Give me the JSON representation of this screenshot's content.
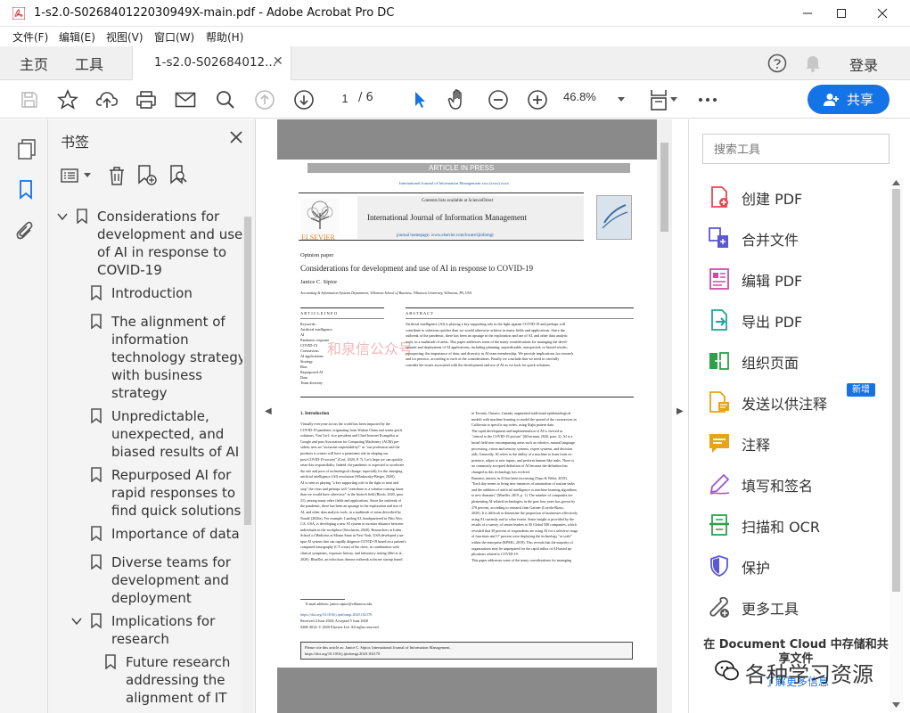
{
  "window": {
    "title": "1-s2.0-S026840122030949X-main.pdf - Adobe Acrobat Pro DC"
  },
  "menu": [
    "文件(F)",
    "编辑(E)",
    "视图(V)",
    "窗口(W)",
    "帮助(H)"
  ],
  "tabs": {
    "home": "主页",
    "tools": "工具",
    "document": "1-s2.0-S02684012...",
    "signin": "登录"
  },
  "toolbar": {
    "page_current": "1",
    "page_total": "/ 6",
    "zoom": "46.8%",
    "share": "共享"
  },
  "bookmarks": {
    "header": "书签",
    "items": [
      {
        "label_lines": [
          "Considerations for",
          "development and use",
          "of AI in response to",
          "COVID-19"
        ]
      },
      {
        "label_lines": [
          "Introduction"
        ]
      },
      {
        "label_lines": [
          "The alignment of",
          "information",
          "technology strategy",
          "with business",
          "strategy"
        ]
      },
      {
        "label_lines": [
          "Unpredictable,",
          "unexpected, and",
          "biased results of AI"
        ]
      },
      {
        "label_lines": [
          "Repurposed AI for",
          "rapid responses to",
          "find quick solutions"
        ]
      },
      {
        "label_lines": [
          "Importance of data"
        ]
      },
      {
        "label_lines": [
          "Diverse teams for",
          "development and",
          "deployment"
        ]
      },
      {
        "label_lines": [
          "Implications for",
          "research"
        ]
      },
      {
        "label_lines": [
          "Future research",
          "addressing the",
          "alignment of IT"
        ]
      }
    ]
  },
  "pdf": {
    "banner": "ARTICLE IN PRESS",
    "journal_ref": "International Journal of Information Management xxx (xxxx) xxxx",
    "contents_line": "Contents lists available at ScienceDirect",
    "journal_name": "International Journal of Information Management",
    "homepage": "journal homepage: www.elsevier.com/locate/ijinfomgt",
    "publisher": "ELSEVIER",
    "type": "Opinion paper",
    "title": "Considerations for development and use of AI in response to COVID-19",
    "author": "Janice C. Sipior",
    "affiliation": "Accounting & Information Systems Department, Villanova School of Business, Villanova University, Villanova, PA, USA",
    "article_info_hdr": "A R T I C L E   I N F O",
    "abstract_hdr": "A B S T R A C T",
    "keywords": [
      "Keywords:",
      "Artificial intelligence",
      "AI",
      "Pandemic response",
      "COVID-19",
      "Coronavirus",
      "AI applications",
      "Strategy",
      "Bias",
      "Repurposed AI",
      "Data",
      "Team diversity"
    ],
    "abstract_lines": [
      "Artificial intelligence (AI) is playing a key supporting role in the fight against COVID-19 and perhaps will",
      "contribute to solutions quicker than we would otherwise achieve in many fields and applications. Since the",
      "outbreak of the pandemic, there has been an upsurge in the exploration and use of AI, and other data analytic",
      "tools, in a multitude of areas. This paper addresses some of the many considerations for managing the devel-",
      "opment and deployment of AI applications, including planning; unpredictable, unexpected, or biased results;",
      "repurposing; the importance of data; and diversity in AI team membership. We provide implications for research",
      "and for practice, according to each of the considerations. Finally we conclude that we need to carefully",
      "consider the issues associated with the development and use of AI as we look for quick solutions."
    ],
    "section1": "1. Introduction",
    "col1_lines": [
      "Virtually everyone across the world has been impacted by the",
      "COVID-19 pandemic originating from Wuhan China and wants quick",
      "solutions. Vint Cerf, vice president and Chief Internet Evangelist at",
      "Google and past Association for Computing Machinery (ACM) pre-",
      "sident, sees an \"awesome responsibility!\" as \"our profession and the",
      "products it creates will have a prominent role in shaping our",
      "post-COVID-19 society\" (Cerf, 2020, P. 7). Let's hope we can quickly",
      "seize this responsibility. Indeed, the pandemic is expected to accelerate",
      "the rate and pace of technological change, especially for the emerging",
      "artificial intelligence (AI) revolution (Wladawsky-Berger, 2020).",
      "AI is seen as playing \"a key supporting role in the fight to treat and",
      "stop\" the virus and perhaps will \"contribute to a solution coming faster",
      "than we would have otherwise\" in the biotech field (Bloch, 2020, para.",
      "21), among many other fields and applications. Since the outbreak of",
      "the pandemic, there has been an upsurge in the exploration and use of",
      "AI, and other data analytic tools, in a multitude of areas described by",
      "Naudé (2020a). For example, Landing AI, headquartered in Palo Alto,",
      "CA, USA, is developing a new AI system to monitor distance between",
      "individuals in the workplace (Seecharan, 2020). Researchers at Icahn",
      "School of Medicine at Mount Sinai in New York, USA developed a un-",
      "ique AI system that can rapidly diagnose COVID-19 based on a patient's",
      "computed tomography (CT scans) of the chest, in combination with",
      "clinical symptoms, exposure history, and laboratory testing (Mei et al.,",
      "2020). BlueDot, an infectious disease outbreak software startup based"
    ],
    "col2_lines": [
      "in Toronto, Ontario, Canada, augmented traditional epidemiological",
      "models with machine learning to model the spread of the coronavirus in",
      "California to specific zip codes, using flight pattern data.",
      "The rapid development and implementation of AI is viewed as",
      "\"central to the COVID-19 picture\" (Silverman, 2020, para. 2). AI is a",
      "broad field now encompassing areas such as robotics, natural language",
      "processing, vision and sensory systems, expert systems, and decision",
      "aids. Generally, AI refers to the ability of a machine to learn from ex-",
      "perience, adjust to new inputs, and perform human-like tasks. There is",
      "no commonly accepted definition of AI because the definition has",
      "changed as this technology has evolved.",
      "Business interest in AI has been increasing (Tapo & Welat, 2018).",
      "\"Each day seems to bring new instances of automation of routine tasks",
      "and the addition of artificial intelligence or machine learning algorithms",
      "to new domains\" (Mueller, 2019, p. 1). The number of companies im-",
      "plementing AI-related technologies in the past four years has grown by",
      "270 percent, according to research firm Gartner (Loyola-Rizzo,",
      "2020). It is difficult to determine the proportion of businesses effectively",
      "using AI currently and to what extent. Some insight is provided by the",
      "results of a survey, of senior leaders at 30 Global 500 companies, which",
      "revealed that 30 percent of respondents are using AI for a selective range",
      "of functions and 17 percent were deploying the technology \"at scale\"",
      "within the enterprise (KPMG, 2019). This reveals that the majority of",
      "organizations may be unprepared for the rapid influx of AI-based ap-",
      "plications related to COVID-19.",
      "This paper addresses some of the many considerations for managing"
    ],
    "email": "E-mail address: janice.sipior@villanova.edu.",
    "doi": "https://doi.org/10.1016/j.ijinfomgt.2020.102170",
    "received": "Received 4 June 2020; Accepted 5 June 2020",
    "copyright": "0268-4012/ © 2020 Elsevier Ltd. All rights reserved.",
    "cite_lines": [
      "Please cite this article as: Janice C. Sipior, International Journal of Information Management,",
      "https://doi.org/10.1016/j.ijinfomgt.2020.102170"
    ],
    "overlay_watermark": "和泉信公众号"
  },
  "tools_panel": {
    "search_placeholder": "搜索工具",
    "items": [
      {
        "label": "创建 PDF",
        "icon": "create-pdf-icon",
        "color": "#e34850"
      },
      {
        "label": "合并文件",
        "icon": "combine-files-icon",
        "color": "#5a58d6"
      },
      {
        "label": "编辑 PDF",
        "icon": "edit-pdf-icon",
        "color": "#d04aa7"
      },
      {
        "label": "导出 PDF",
        "icon": "export-pdf-icon",
        "color": "#1aa69d"
      },
      {
        "label": "组织页面",
        "icon": "organize-pages-icon",
        "color": "#2ea04a"
      },
      {
        "label": "发送以供注释",
        "icon": "send-comments-icon",
        "color": "#e8a317"
      },
      {
        "label": "注释",
        "icon": "comment-icon",
        "color": "#e8a317"
      },
      {
        "label": "填写和签名",
        "icon": "fill-sign-icon",
        "color": "#9b55d6"
      },
      {
        "label": "扫描和 OCR",
        "icon": "scan-ocr-icon",
        "color": "#2ea04a"
      },
      {
        "label": "保护",
        "icon": "protect-icon",
        "color": "#5a58d6"
      },
      {
        "label": "更多工具",
        "icon": "more-tools-icon",
        "color": "#555555"
      }
    ],
    "new_badge": "新增",
    "footer_title": "在 Document Cloud 中存储和共享文件",
    "footer_link": "了解更多信息"
  },
  "overlay_watermark": "各种学习资源",
  "colors": {
    "accent": "#1473e6",
    "canvas": "#8a8a8a"
  }
}
